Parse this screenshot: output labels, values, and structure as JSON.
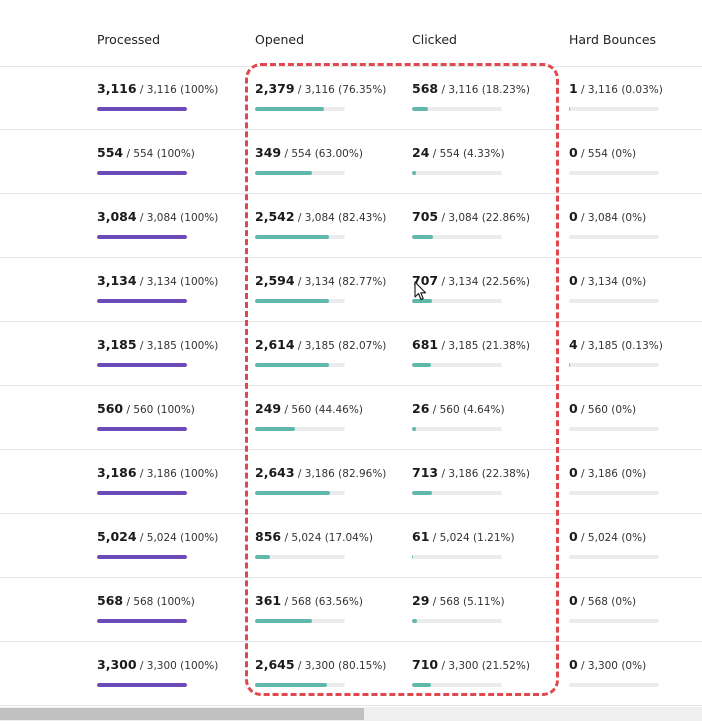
{
  "columns": [
    "Processed",
    "Opened",
    "Clicked",
    "Hard Bounces"
  ],
  "rows": [
    {
      "processed": {
        "count": "3,116",
        "detail": "/ 3,116 (100%)",
        "fraction": 1.0
      },
      "opened": {
        "count": "2,379",
        "detail": "/ 3,116 (76.35%)",
        "fraction": 0.7635
      },
      "clicked": {
        "count": "568",
        "detail": "/ 3,116 (18.23%)",
        "fraction": 0.1823
      },
      "hard_bounces": {
        "count": "1",
        "detail": "/ 3,116 (0.03%)",
        "fraction": 0.0003
      }
    },
    {
      "processed": {
        "count": "554",
        "detail": "/ 554 (100%)",
        "fraction": 1.0
      },
      "opened": {
        "count": "349",
        "detail": "/ 554 (63.00%)",
        "fraction": 0.63
      },
      "clicked": {
        "count": "24",
        "detail": "/ 554 (4.33%)",
        "fraction": 0.0433
      },
      "hard_bounces": {
        "count": "0",
        "detail": "/ 554 (0%)",
        "fraction": 0
      }
    },
    {
      "processed": {
        "count": "3,084",
        "detail": "/ 3,084 (100%)",
        "fraction": 1.0
      },
      "opened": {
        "count": "2,542",
        "detail": "/ 3,084 (82.43%)",
        "fraction": 0.8243
      },
      "clicked": {
        "count": "705",
        "detail": "/ 3,084 (22.86%)",
        "fraction": 0.2286
      },
      "hard_bounces": {
        "count": "0",
        "detail": "/ 3,084 (0%)",
        "fraction": 0
      }
    },
    {
      "processed": {
        "count": "3,134",
        "detail": "/ 3,134 (100%)",
        "fraction": 1.0
      },
      "opened": {
        "count": "2,594",
        "detail": "/ 3,134 (82.77%)",
        "fraction": 0.8277
      },
      "clicked": {
        "count": "707",
        "detail": "/ 3,134 (22.56%)",
        "fraction": 0.2256
      },
      "hard_bounces": {
        "count": "0",
        "detail": "/ 3,134 (0%)",
        "fraction": 0
      }
    },
    {
      "processed": {
        "count": "3,185",
        "detail": "/ 3,185 (100%)",
        "fraction": 1.0
      },
      "opened": {
        "count": "2,614",
        "detail": "/ 3,185 (82.07%)",
        "fraction": 0.8207
      },
      "clicked": {
        "count": "681",
        "detail": "/ 3,185 (21.38%)",
        "fraction": 0.2138
      },
      "hard_bounces": {
        "count": "4",
        "detail": "/ 3,185 (0.13%)",
        "fraction": 0.0013
      }
    },
    {
      "processed": {
        "count": "560",
        "detail": "/ 560 (100%)",
        "fraction": 1.0
      },
      "opened": {
        "count": "249",
        "detail": "/ 560 (44.46%)",
        "fraction": 0.4446
      },
      "clicked": {
        "count": "26",
        "detail": "/ 560 (4.64%)",
        "fraction": 0.0464
      },
      "hard_bounces": {
        "count": "0",
        "detail": "/ 560 (0%)",
        "fraction": 0
      }
    },
    {
      "processed": {
        "count": "3,186",
        "detail": "/ 3,186 (100%)",
        "fraction": 1.0
      },
      "opened": {
        "count": "2,643",
        "detail": "/ 3,186 (82.96%)",
        "fraction": 0.8296
      },
      "clicked": {
        "count": "713",
        "detail": "/ 3,186 (22.38%)",
        "fraction": 0.2238
      },
      "hard_bounces": {
        "count": "0",
        "detail": "/ 3,186 (0%)",
        "fraction": 0
      }
    },
    {
      "processed": {
        "count": "5,024",
        "detail": "/ 5,024 (100%)",
        "fraction": 1.0
      },
      "opened": {
        "count": "856",
        "detail": "/ 5,024 (17.04%)",
        "fraction": 0.1704
      },
      "clicked": {
        "count": "61",
        "detail": "/ 5,024 (1.21%)",
        "fraction": 0.0121
      },
      "hard_bounces": {
        "count": "0",
        "detail": "/ 5,024 (0%)",
        "fraction": 0
      }
    },
    {
      "processed": {
        "count": "568",
        "detail": "/ 568 (100%)",
        "fraction": 1.0
      },
      "opened": {
        "count": "361",
        "detail": "/ 568 (63.56%)",
        "fraction": 0.6356
      },
      "clicked": {
        "count": "29",
        "detail": "/ 568 (5.11%)",
        "fraction": 0.0511
      },
      "hard_bounces": {
        "count": "0",
        "detail": "/ 568 (0%)",
        "fraction": 0
      }
    },
    {
      "processed": {
        "count": "3,300",
        "detail": "/ 3,300 (100%)",
        "fraction": 1.0
      },
      "opened": {
        "count": "2,645",
        "detail": "/ 3,300 (80.15%)",
        "fraction": 0.8015
      },
      "clicked": {
        "count": "710",
        "detail": "/ 3,300 (21.52%)",
        "fraction": 0.2152
      },
      "hard_bounces": {
        "count": "0",
        "detail": "/ 3,300 (0%)",
        "fraction": 0
      }
    }
  ],
  "colors": {
    "processed_bar": "#6c4bb6",
    "rate_bar": "#5fb8ab",
    "highlight": "#e0484d"
  },
  "icons": {
    "cursor": "mouse-pointer-icon"
  }
}
